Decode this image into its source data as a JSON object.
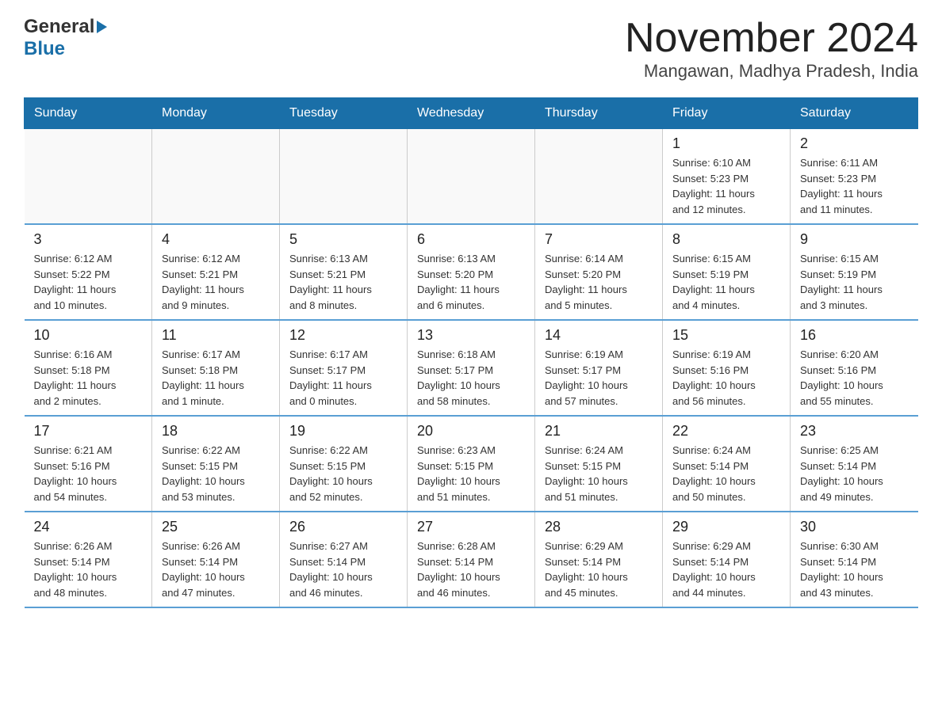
{
  "header": {
    "logo_general": "General",
    "logo_blue": "Blue",
    "title": "November 2024",
    "subtitle": "Mangawan, Madhya Pradesh, India"
  },
  "weekdays": [
    "Sunday",
    "Monday",
    "Tuesday",
    "Wednesday",
    "Thursday",
    "Friday",
    "Saturday"
  ],
  "weeks": [
    [
      {
        "day": "",
        "info": ""
      },
      {
        "day": "",
        "info": ""
      },
      {
        "day": "",
        "info": ""
      },
      {
        "day": "",
        "info": ""
      },
      {
        "day": "",
        "info": ""
      },
      {
        "day": "1",
        "info": "Sunrise: 6:10 AM\nSunset: 5:23 PM\nDaylight: 11 hours\nand 12 minutes."
      },
      {
        "day": "2",
        "info": "Sunrise: 6:11 AM\nSunset: 5:23 PM\nDaylight: 11 hours\nand 11 minutes."
      }
    ],
    [
      {
        "day": "3",
        "info": "Sunrise: 6:12 AM\nSunset: 5:22 PM\nDaylight: 11 hours\nand 10 minutes."
      },
      {
        "day": "4",
        "info": "Sunrise: 6:12 AM\nSunset: 5:21 PM\nDaylight: 11 hours\nand 9 minutes."
      },
      {
        "day": "5",
        "info": "Sunrise: 6:13 AM\nSunset: 5:21 PM\nDaylight: 11 hours\nand 8 minutes."
      },
      {
        "day": "6",
        "info": "Sunrise: 6:13 AM\nSunset: 5:20 PM\nDaylight: 11 hours\nand 6 minutes."
      },
      {
        "day": "7",
        "info": "Sunrise: 6:14 AM\nSunset: 5:20 PM\nDaylight: 11 hours\nand 5 minutes."
      },
      {
        "day": "8",
        "info": "Sunrise: 6:15 AM\nSunset: 5:19 PM\nDaylight: 11 hours\nand 4 minutes."
      },
      {
        "day": "9",
        "info": "Sunrise: 6:15 AM\nSunset: 5:19 PM\nDaylight: 11 hours\nand 3 minutes."
      }
    ],
    [
      {
        "day": "10",
        "info": "Sunrise: 6:16 AM\nSunset: 5:18 PM\nDaylight: 11 hours\nand 2 minutes."
      },
      {
        "day": "11",
        "info": "Sunrise: 6:17 AM\nSunset: 5:18 PM\nDaylight: 11 hours\nand 1 minute."
      },
      {
        "day": "12",
        "info": "Sunrise: 6:17 AM\nSunset: 5:17 PM\nDaylight: 11 hours\nand 0 minutes."
      },
      {
        "day": "13",
        "info": "Sunrise: 6:18 AM\nSunset: 5:17 PM\nDaylight: 10 hours\nand 58 minutes."
      },
      {
        "day": "14",
        "info": "Sunrise: 6:19 AM\nSunset: 5:17 PM\nDaylight: 10 hours\nand 57 minutes."
      },
      {
        "day": "15",
        "info": "Sunrise: 6:19 AM\nSunset: 5:16 PM\nDaylight: 10 hours\nand 56 minutes."
      },
      {
        "day": "16",
        "info": "Sunrise: 6:20 AM\nSunset: 5:16 PM\nDaylight: 10 hours\nand 55 minutes."
      }
    ],
    [
      {
        "day": "17",
        "info": "Sunrise: 6:21 AM\nSunset: 5:16 PM\nDaylight: 10 hours\nand 54 minutes."
      },
      {
        "day": "18",
        "info": "Sunrise: 6:22 AM\nSunset: 5:15 PM\nDaylight: 10 hours\nand 53 minutes."
      },
      {
        "day": "19",
        "info": "Sunrise: 6:22 AM\nSunset: 5:15 PM\nDaylight: 10 hours\nand 52 minutes."
      },
      {
        "day": "20",
        "info": "Sunrise: 6:23 AM\nSunset: 5:15 PM\nDaylight: 10 hours\nand 51 minutes."
      },
      {
        "day": "21",
        "info": "Sunrise: 6:24 AM\nSunset: 5:15 PM\nDaylight: 10 hours\nand 51 minutes."
      },
      {
        "day": "22",
        "info": "Sunrise: 6:24 AM\nSunset: 5:14 PM\nDaylight: 10 hours\nand 50 minutes."
      },
      {
        "day": "23",
        "info": "Sunrise: 6:25 AM\nSunset: 5:14 PM\nDaylight: 10 hours\nand 49 minutes."
      }
    ],
    [
      {
        "day": "24",
        "info": "Sunrise: 6:26 AM\nSunset: 5:14 PM\nDaylight: 10 hours\nand 48 minutes."
      },
      {
        "day": "25",
        "info": "Sunrise: 6:26 AM\nSunset: 5:14 PM\nDaylight: 10 hours\nand 47 minutes."
      },
      {
        "day": "26",
        "info": "Sunrise: 6:27 AM\nSunset: 5:14 PM\nDaylight: 10 hours\nand 46 minutes."
      },
      {
        "day": "27",
        "info": "Sunrise: 6:28 AM\nSunset: 5:14 PM\nDaylight: 10 hours\nand 46 minutes."
      },
      {
        "day": "28",
        "info": "Sunrise: 6:29 AM\nSunset: 5:14 PM\nDaylight: 10 hours\nand 45 minutes."
      },
      {
        "day": "29",
        "info": "Sunrise: 6:29 AM\nSunset: 5:14 PM\nDaylight: 10 hours\nand 44 minutes."
      },
      {
        "day": "30",
        "info": "Sunrise: 6:30 AM\nSunset: 5:14 PM\nDaylight: 10 hours\nand 43 minutes."
      }
    ]
  ]
}
